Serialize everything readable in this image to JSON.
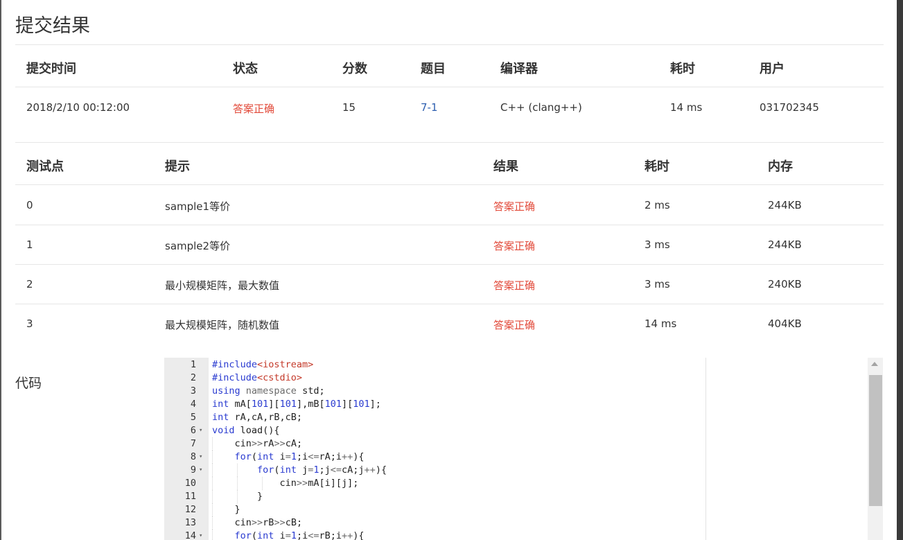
{
  "title": "提交结果",
  "submission": {
    "headers": [
      "提交时间",
      "状态",
      "分数",
      "题目",
      "编译器",
      "耗时",
      "用户"
    ],
    "row": {
      "time": "2018/2/10 00:12:00",
      "status": "答案正确",
      "score": "15",
      "problem": "7-1",
      "compiler": "C++ (clang++)",
      "duration": "14 ms",
      "user": "031702345"
    }
  },
  "tests": {
    "headers": [
      "测试点",
      "提示",
      "结果",
      "耗时",
      "内存"
    ],
    "rows": [
      {
        "id": "0",
        "hint": "sample1等价",
        "result": "答案正确",
        "time": "2 ms",
        "memory": "244KB"
      },
      {
        "id": "1",
        "hint": "sample2等价",
        "result": "答案正确",
        "time": "3 ms",
        "memory": "244KB"
      },
      {
        "id": "2",
        "hint": "最小规模矩阵，最大数值",
        "result": "答案正确",
        "time": "3 ms",
        "memory": "240KB"
      },
      {
        "id": "3",
        "hint": "最大规模矩阵，随机数值",
        "result": "答案正确",
        "time": "14 ms",
        "memory": "404KB"
      }
    ]
  },
  "code_label": "代码",
  "code_lines": [
    {
      "n": "1",
      "text": "#include<iostream>"
    },
    {
      "n": "2",
      "text": "#include<cstdio>"
    },
    {
      "n": "3",
      "text": "using namespace std;"
    },
    {
      "n": "4",
      "text": "int mA[101][101],mB[101][101];"
    },
    {
      "n": "5",
      "text": "int rA,cA,rB,cB;"
    },
    {
      "n": "6",
      "text": "void load(){"
    },
    {
      "n": "7",
      "text": "    cin>>rA>>cA;"
    },
    {
      "n": "8",
      "text": "    for(int i=1;i<=rA;i++){"
    },
    {
      "n": "9",
      "text": "        for(int j=1;j<=cA;j++){"
    },
    {
      "n": "10",
      "text": "            cin>>mA[i][j];"
    },
    {
      "n": "11",
      "text": "        }"
    },
    {
      "n": "12",
      "text": "    }"
    },
    {
      "n": "13",
      "text": "    cin>>rB>>cB;"
    },
    {
      "n": "14",
      "text": "    for(int i=1;i<=rB;i++){"
    }
  ],
  "colors": {
    "status_ok": "#e24a3a",
    "link": "#2d5fb0"
  }
}
